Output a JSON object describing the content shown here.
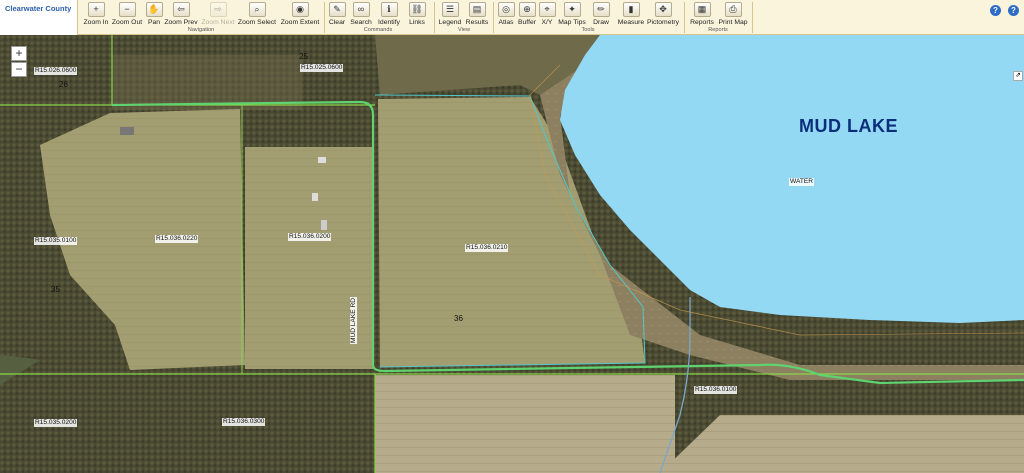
{
  "brand": "Clearwater County",
  "toolbar": {
    "tools": [
      {
        "label": "Zoom In",
        "icon": "zoom-in-icon",
        "glyph": "+"
      },
      {
        "label": "Zoom Out",
        "icon": "zoom-out-icon",
        "glyph": "−"
      },
      {
        "label": "Pan",
        "icon": "pan-hand-icon",
        "glyph": "✋"
      },
      {
        "label": "Zoom Prev",
        "icon": "back-arrow-icon",
        "glyph": "⇦"
      },
      {
        "label": "Zoom Next",
        "icon": "forward-arrow-icon",
        "glyph": "⇨",
        "disabled": true
      },
      {
        "label": "Zoom Select",
        "icon": "zoom-select-icon",
        "glyph": "⌕"
      },
      {
        "label": "Zoom Extent",
        "icon": "globe-icon",
        "glyph": "◉"
      },
      {
        "label": "Clear",
        "icon": "eraser-icon",
        "glyph": "✎"
      },
      {
        "label": "Search",
        "icon": "binoculars-icon",
        "glyph": "∞"
      },
      {
        "label": "Identify",
        "icon": "identify-icon",
        "glyph": "ℹ"
      },
      {
        "label": "Links",
        "icon": "links-icon",
        "glyph": "⛓"
      },
      {
        "label": "Legend",
        "icon": "legend-icon",
        "glyph": "☰"
      },
      {
        "label": "Results",
        "icon": "results-icon",
        "glyph": "▤"
      },
      {
        "label": "Atlas",
        "icon": "atlas-icon",
        "glyph": "◎"
      },
      {
        "label": "Buffer",
        "icon": "buffer-icon",
        "glyph": "⊕"
      },
      {
        "label": "X/Y",
        "icon": "xy-pin-icon",
        "glyph": "⌖"
      },
      {
        "label": "Map Tips",
        "icon": "map-tips-icon",
        "glyph": "✦"
      },
      {
        "label": "Draw",
        "icon": "pencil-icon",
        "glyph": "✏"
      },
      {
        "label": "Measure",
        "icon": "ruler-icon",
        "glyph": "▮"
      },
      {
        "label": "Pictometry",
        "icon": "pictometry-icon",
        "glyph": "✥"
      },
      {
        "label": "Reports",
        "icon": "reports-icon",
        "glyph": "▦"
      },
      {
        "label": "Print Map",
        "icon": "printer-icon",
        "glyph": "⎙"
      }
    ],
    "groups": [
      "Navigation",
      "Commands",
      "View",
      "Tools",
      "Reports"
    ]
  },
  "header_icons": [
    {
      "icon": "help-icon",
      "glyph": "?"
    },
    {
      "icon": "info-icon",
      "glyph": "?"
    }
  ],
  "map": {
    "zoom_in": "+",
    "zoom_out": "−",
    "collapse": "⇗",
    "lake_name": "MUD LAKE",
    "water_label": "WATER",
    "road_label": "MUD LAKE RD",
    "parcels": [
      "R15.026.0600",
      "R15.025.0600",
      "R15.035.0100",
      "R15.036.0220",
      "R15.036.0200",
      "R15.036.0210",
      "R15.036.0100",
      "R15.035.0200",
      "R15.036.0300"
    ],
    "sections": [
      "26",
      "25",
      "35",
      "36"
    ]
  },
  "colors": {
    "water": "#94d9f3",
    "parcel_line": "#88d64a",
    "road_line": "#5fd36f",
    "lake_line": "#c99a4e",
    "toolbar_bg": "#fbf4dc"
  }
}
